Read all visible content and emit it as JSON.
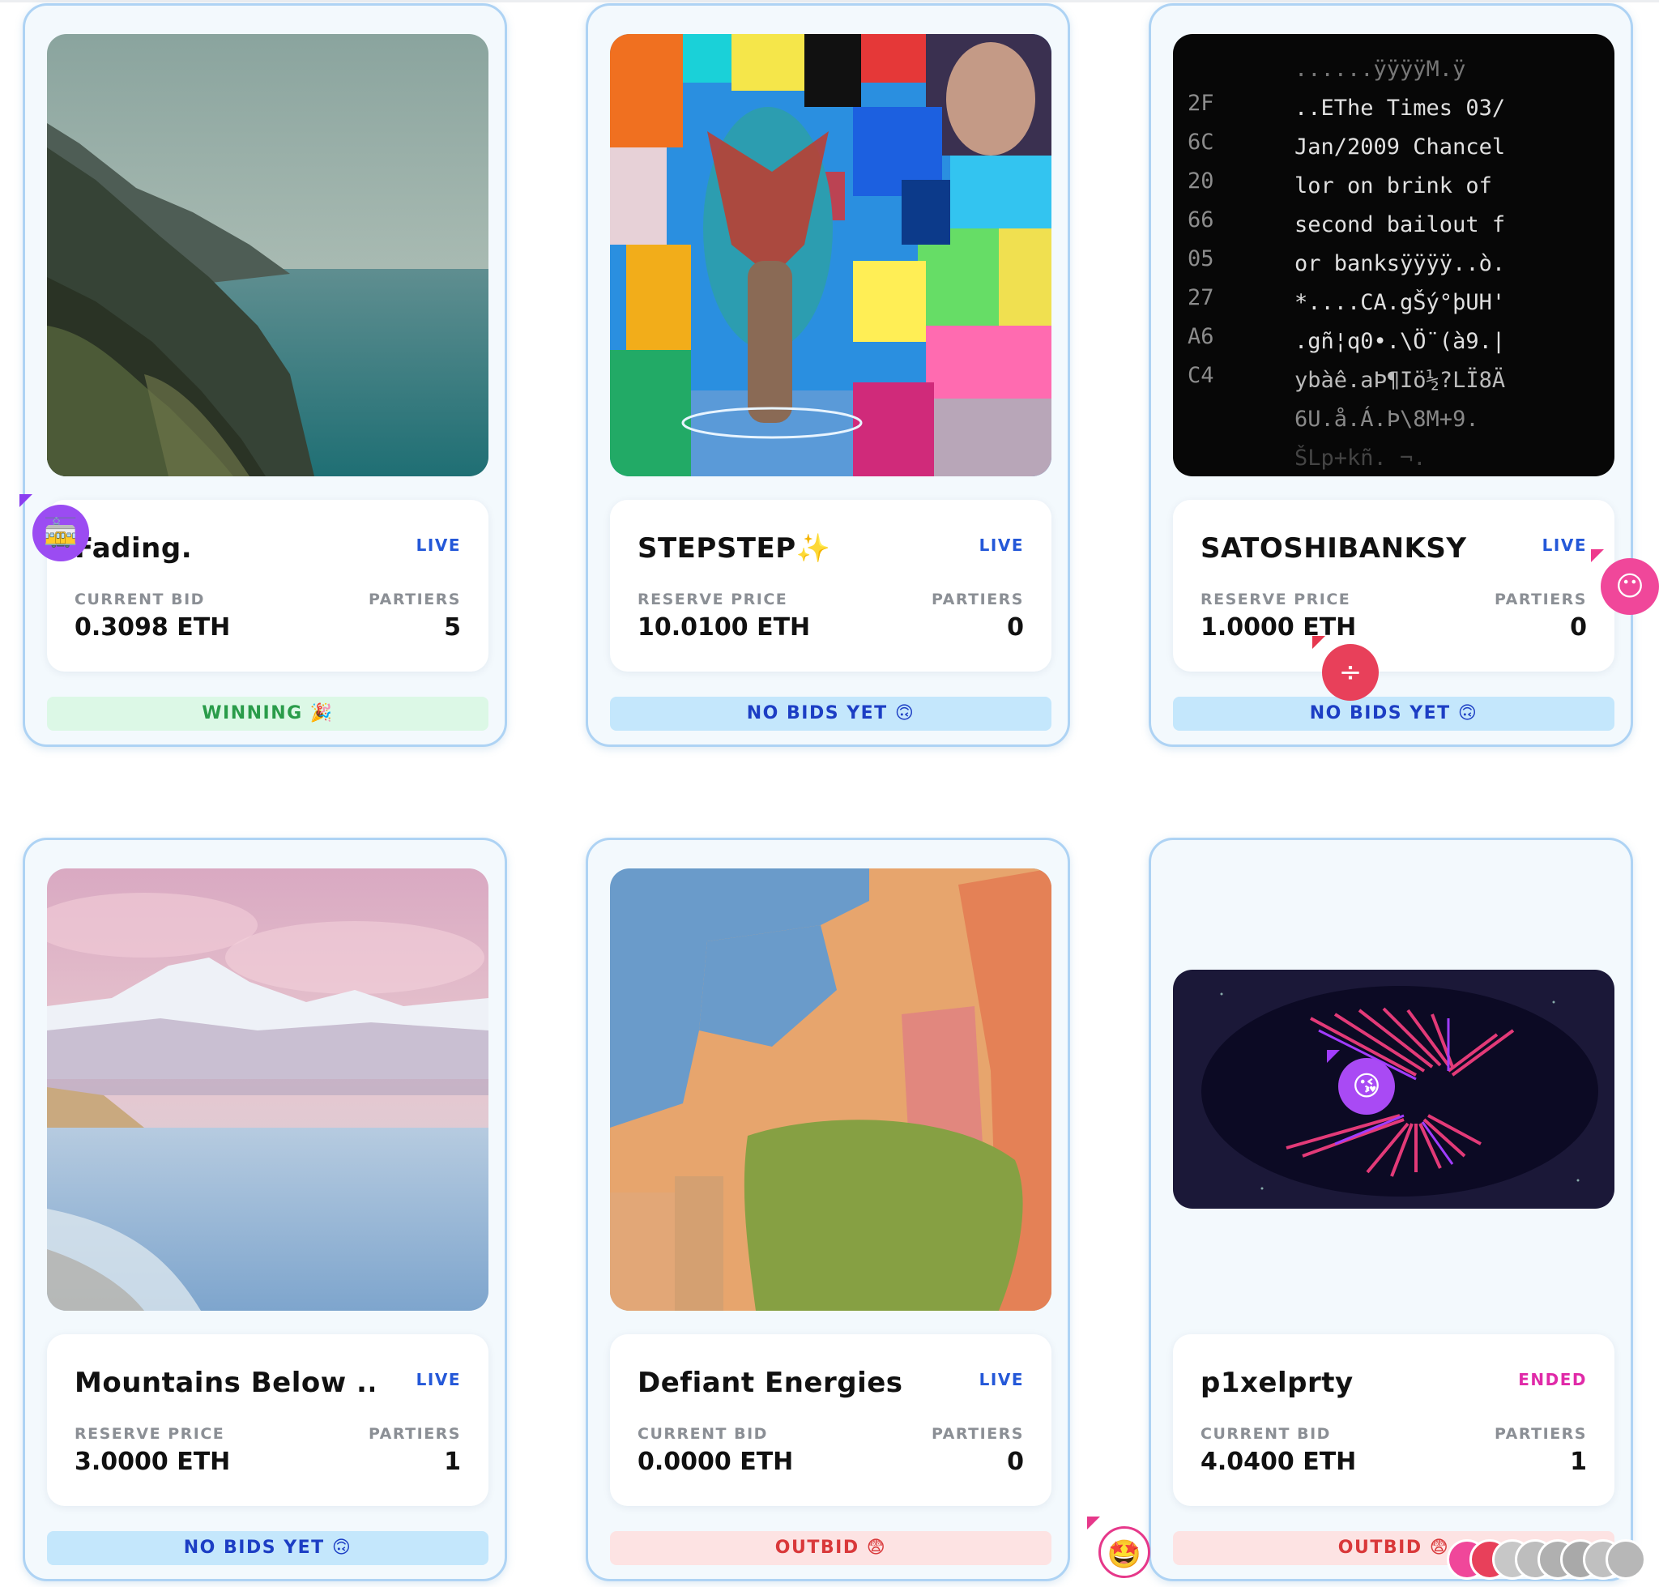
{
  "cards": [
    {
      "title": "Fading.",
      "status": "LIVE",
      "price_label": "CURRENT BID",
      "price": "0.3098 ETH",
      "parties_label": "PARTIERS",
      "parties": "5",
      "badge": "WINNING 🎉"
    },
    {
      "title": "STEPSTEP✨",
      "status": "LIVE",
      "price_label": "RESERVE PRICE",
      "price": "10.0100 ETH",
      "parties_label": "PARTIERS",
      "parties": "0",
      "badge": "NO BIDS YET 🙃"
    },
    {
      "title": "SATOSHIBANKSY",
      "status": "LIVE",
      "price_label": "RESERVE PRICE",
      "price": "1.0000 ETH",
      "parties_label": "PARTIERS",
      "parties": "0",
      "badge": "NO BIDS YET 🙃"
    },
    {
      "title": "Mountains Below ...",
      "status": "LIVE",
      "price_label": "RESERVE PRICE",
      "price": "3.0000 ETH",
      "parties_label": "PARTIERS",
      "parties": "1",
      "badge": "NO BIDS YET 🙃"
    },
    {
      "title": "Defiant Energies",
      "status": "LIVE",
      "price_label": "CURRENT BID",
      "price": "0.0000 ETH",
      "parties_label": "PARTIERS",
      "parties": "0",
      "badge": "OUTBID 😨"
    },
    {
      "title": "p1xelprty",
      "status": "ENDED",
      "price_label": "CURRENT BID",
      "price": "4.0400 ETH",
      "parties_label": "PARTIERS",
      "parties": "1",
      "badge": "OUTBID 😨"
    }
  ],
  "satoshi_text": {
    "hex": [
      "2F",
      "6C",
      "20",
      "66",
      "05",
      "27",
      "A6",
      "C4"
    ],
    "lines": [
      "......ÿÿÿÿM.ÿ",
      "..EThe Times 03/",
      "Jan/2009 Chancel",
      "lor on brink of",
      "second bailout f",
      "or banksÿÿÿÿ..ò.",
      "*....CA.gŠý°þUH'",
      ".gñ¦q0•.\\Ö¨(à9.|",
      "ybàê.aÞ¶Iö½?LÏ8Ä",
      "6U.å.Á.Þ\\8M+9.",
      "ŠLp+kñ. ¬."
    ]
  },
  "cursors": [
    "🚋",
    "😶",
    "÷",
    "😘",
    "🤩"
  ],
  "colors": {
    "live": "#2458d8",
    "ended": "#e02aa8",
    "nobids_bg": "#c4e7fc",
    "winning_bg": "#dcf8e6",
    "outbid_bg": "#fde3e3",
    "card_border": "#aed3f4"
  }
}
